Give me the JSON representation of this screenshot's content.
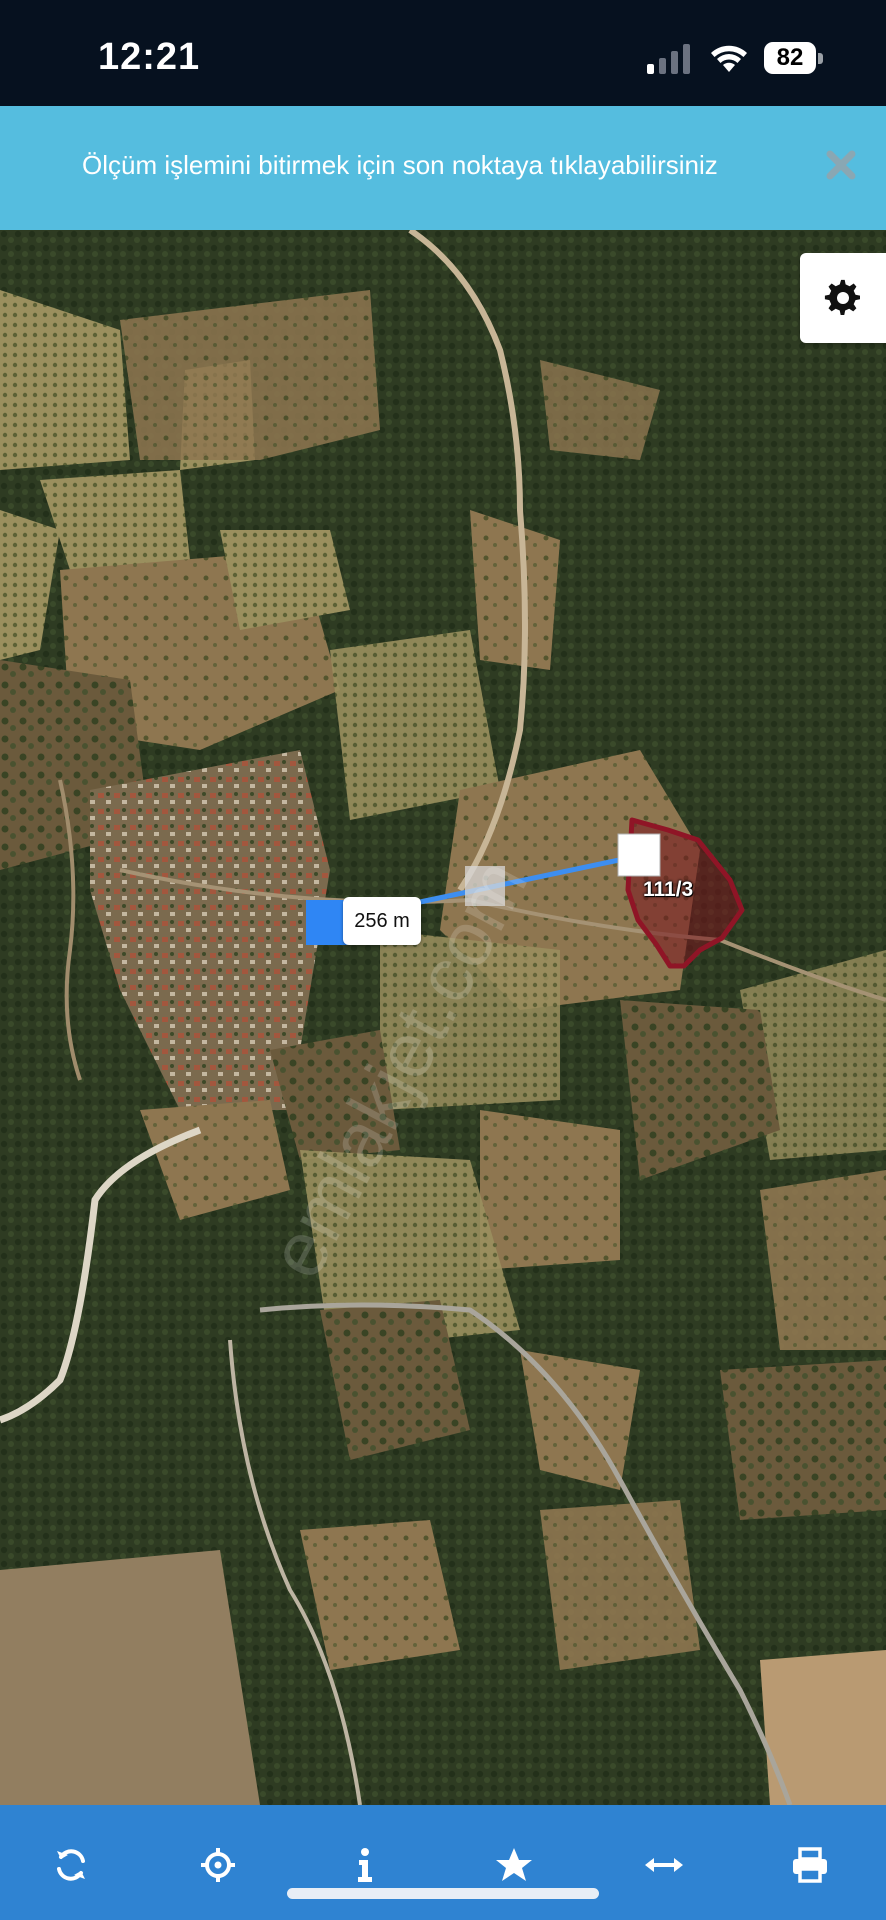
{
  "status_bar": {
    "time": "12:21",
    "battery": "82"
  },
  "banner": {
    "message": "Ölçüm işlemini bitirmek için son noktaya tıklayabilirsiniz"
  },
  "map": {
    "measurement_label": "256 m",
    "parcel_label": "111/3",
    "watermark": "emlakjet.com"
  },
  "colors": {
    "banner": "#55bddf",
    "toolbar": "#2f83d2",
    "measure_line": "#3d8ef0",
    "parcel_outline": "#8f1526"
  },
  "toolbar": {
    "icons": [
      "refresh-icon",
      "locate-icon",
      "info-icon",
      "star-icon",
      "measure-icon",
      "print-icon"
    ]
  }
}
